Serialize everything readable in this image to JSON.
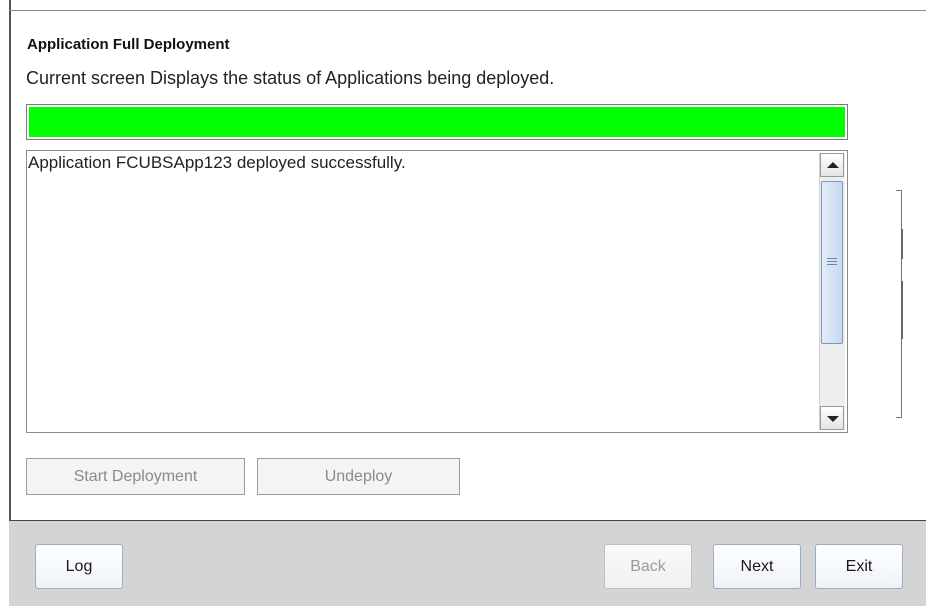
{
  "panel": {
    "title": "Application Full Deployment",
    "subtitle": "Current screen Displays the status of Applications being deployed."
  },
  "progress": {
    "fraction": 1.0,
    "color": "#00ff00"
  },
  "log": {
    "lines": [
      "Application FCUBSApp123 deployed successfully."
    ]
  },
  "actions": {
    "start_deployment_label": "Start Deployment",
    "undeploy_label": "Undeploy"
  },
  "footer": {
    "log_label": "Log",
    "back_label": "Back",
    "next_label": "Next",
    "exit_label": "Exit"
  }
}
